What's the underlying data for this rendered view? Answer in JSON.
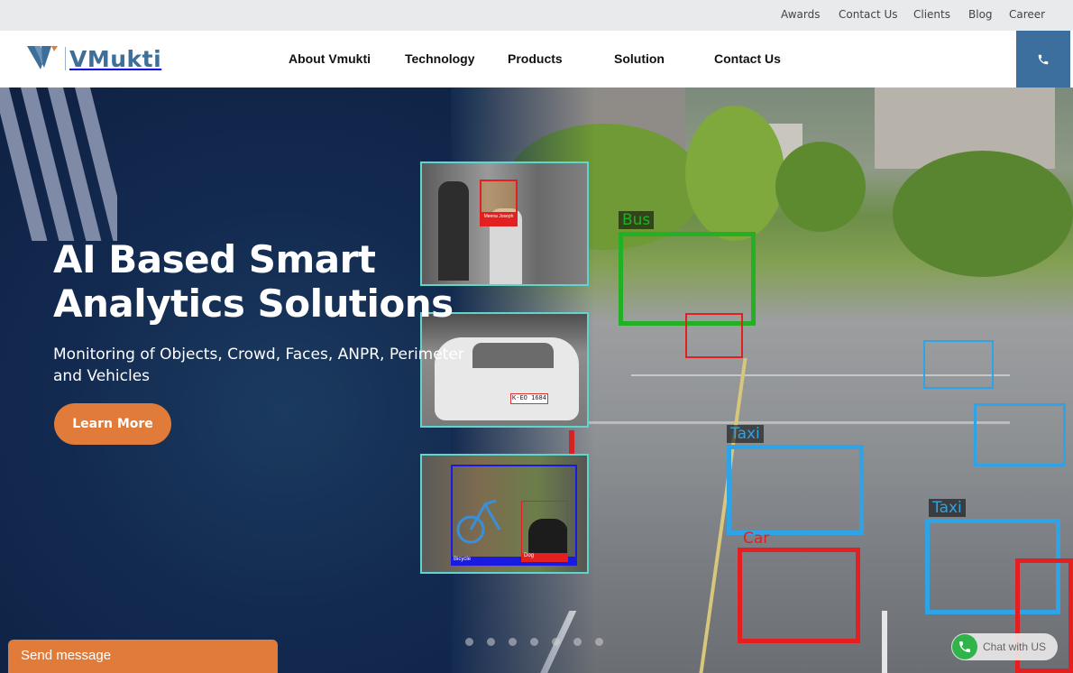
{
  "topbar": {
    "links": [
      "Awards",
      "Contact Us",
      "Clients",
      "Blog",
      "Career"
    ]
  },
  "brand": {
    "name": "VMukti",
    "color": "#3d6f99",
    "accent": "#e07b39"
  },
  "nav": {
    "items": [
      "About Vmukti",
      "Technology",
      "Products",
      "Solution",
      "Contact Us"
    ],
    "phone_icon": "phone-icon"
  },
  "hero": {
    "title_line1": "AI Based Smart",
    "title_line2": "Analytics Solutions",
    "subtitle": "Monitoring of Objects, Crowd, Faces, ANPR, Perimeter and Vehicles",
    "cta": "Learn More",
    "thumbnails": [
      {
        "name": "face-recognition",
        "label": "Meena Joseph"
      },
      {
        "name": "anpr",
        "plate": "K-EO 1684"
      },
      {
        "name": "object-detection",
        "labels": [
          "Bicycle",
          "Dog"
        ]
      }
    ],
    "detections": [
      "Bus",
      "Taxi",
      "Car",
      "Taxi",
      "Taxi"
    ],
    "slides": 7,
    "active_slide": 5
  },
  "widgets": {
    "send_message": "Send message",
    "chat": "Chat with US"
  },
  "colors": {
    "nav_bg": "#ffffff",
    "topbar_bg": "#e9eaec",
    "hero_bg": "#132a50",
    "phone_bg": "#3d6f9e",
    "cta": "#e07b39",
    "thumb_border": "#5fd6cc",
    "det_green": "#22b024",
    "det_red": "#e41f1f",
    "det_blue": "#2ea3e6"
  }
}
